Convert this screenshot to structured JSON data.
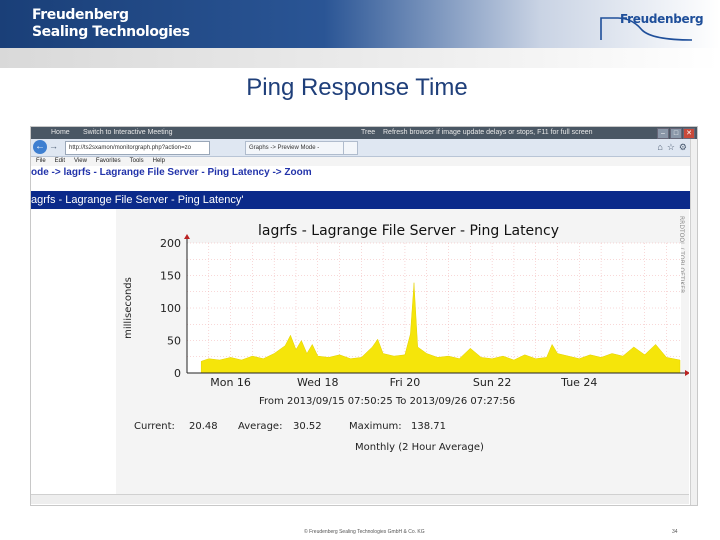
{
  "brand": {
    "line1": "Freudenberg",
    "line2": "Sealing Technologies",
    "logo_text": "Freudenberg"
  },
  "slide": {
    "title": "Ping Response Time"
  },
  "browser": {
    "top_labels": [
      "Home",
      "Switch to Interactive Meeting",
      "Tree",
      "Refresh browser if image update delays or stops, F11 for full screen"
    ],
    "url": "http://ts2sxamon/monitorgraph.php?action=zo",
    "tabs": [
      "Graphs -> Preview Mode -",
      ""
    ],
    "menu": [
      "File",
      "Edit",
      "View",
      "Favorites",
      "Tools",
      "Help"
    ],
    "breadcrumb": "ode -> lagrfs - Lagrange File Server - Ping Latency -> Zoom",
    "page_header": "agrfs - Lagrange File Server - Ping Latency'"
  },
  "graph": {
    "title": "lagrfs - Lagrange File Server - Ping Latency",
    "ylabel": "milliseconds",
    "side_label": "RRDTOOL / TOBI OETIKER",
    "range_text": "From 2013/09/15 07:50:25 To 2013/09/26 07:27:56",
    "stats": {
      "current_label": "Current:",
      "current": "20.48",
      "average_label": "Average:",
      "average": "30.52",
      "maximum_label": "Maximum:",
      "maximum": "138.71"
    },
    "footer": "Monthly (2 Hour Average)"
  },
  "chart_data": {
    "type": "area",
    "title": "lagrfs - Lagrange File Server - Ping Latency",
    "xlabel": "",
    "ylabel": "milliseconds",
    "ylim": [
      0,
      200
    ],
    "yticks": [
      0,
      50,
      100,
      150,
      200
    ],
    "xlim_days": [
      "2013-09-15",
      "2013-09-26"
    ],
    "x_tick_labels": [
      {
        "label": "Mon 16",
        "date": "2013-09-16"
      },
      {
        "label": "Wed 18",
        "date": "2013-09-18"
      },
      {
        "label": "Fri 20",
        "date": "2013-09-20"
      },
      {
        "label": "Sun 22",
        "date": "2013-09-22"
      },
      {
        "label": "Tue 24",
        "date": "2013-09-24"
      }
    ],
    "grid": true,
    "series": [
      {
        "name": "",
        "color": "#f5e50a",
        "points": [
          [
            "2013-09-15 07:50",
            18
          ],
          [
            "2013-09-15 12:00",
            22
          ],
          [
            "2013-09-15 18:00",
            20
          ],
          [
            "2013-09-16 00:00",
            24
          ],
          [
            "2013-09-16 06:00",
            20
          ],
          [
            "2013-09-16 12:00",
            26
          ],
          [
            "2013-09-16 18:00",
            22
          ],
          [
            "2013-09-17 00:00",
            30
          ],
          [
            "2013-09-17 06:00",
            42
          ],
          [
            "2013-09-17 09:00",
            58
          ],
          [
            "2013-09-17 12:00",
            36
          ],
          [
            "2013-09-17 15:00",
            50
          ],
          [
            "2013-09-17 18:00",
            30
          ],
          [
            "2013-09-17 21:00",
            44
          ],
          [
            "2013-09-18 00:00",
            26
          ],
          [
            "2013-09-18 06:00",
            24
          ],
          [
            "2013-09-18 12:00",
            28
          ],
          [
            "2013-09-18 18:00",
            22
          ],
          [
            "2013-09-19 00:00",
            24
          ],
          [
            "2013-09-19 06:00",
            40
          ],
          [
            "2013-09-19 09:00",
            52
          ],
          [
            "2013-09-19 12:00",
            30
          ],
          [
            "2013-09-19 18:00",
            26
          ],
          [
            "2013-09-20 00:00",
            28
          ],
          [
            "2013-09-20 03:00",
            60
          ],
          [
            "2013-09-20 05:00",
            139
          ],
          [
            "2013-09-20 07:00",
            40
          ],
          [
            "2013-09-20 12:00",
            30
          ],
          [
            "2013-09-20 18:00",
            24
          ],
          [
            "2013-09-21 00:00",
            26
          ],
          [
            "2013-09-21 06:00",
            22
          ],
          [
            "2013-09-21 12:00",
            38
          ],
          [
            "2013-09-21 18:00",
            24
          ],
          [
            "2013-09-22 00:00",
            22
          ],
          [
            "2013-09-22 06:00",
            26
          ],
          [
            "2013-09-22 12:00",
            20
          ],
          [
            "2013-09-22 18:00",
            28
          ],
          [
            "2013-09-23 00:00",
            22
          ],
          [
            "2013-09-23 06:00",
            24
          ],
          [
            "2013-09-23 09:00",
            44
          ],
          [
            "2013-09-23 12:00",
            30
          ],
          [
            "2013-09-23 18:00",
            26
          ],
          [
            "2013-09-24 00:00",
            22
          ],
          [
            "2013-09-24 06:00",
            28
          ],
          [
            "2013-09-24 12:00",
            24
          ],
          [
            "2013-09-24 18:00",
            30
          ],
          [
            "2013-09-25 00:00",
            26
          ],
          [
            "2013-09-25 06:00",
            40
          ],
          [
            "2013-09-25 12:00",
            28
          ],
          [
            "2013-09-25 18:00",
            44
          ],
          [
            "2013-09-26 00:00",
            24
          ],
          [
            "2013-09-26 07:27",
            20
          ]
        ]
      }
    ]
  },
  "footer": {
    "copyright": "© Freudenberg Sealing Technologies GmbH & Co. KG",
    "page": "34"
  }
}
